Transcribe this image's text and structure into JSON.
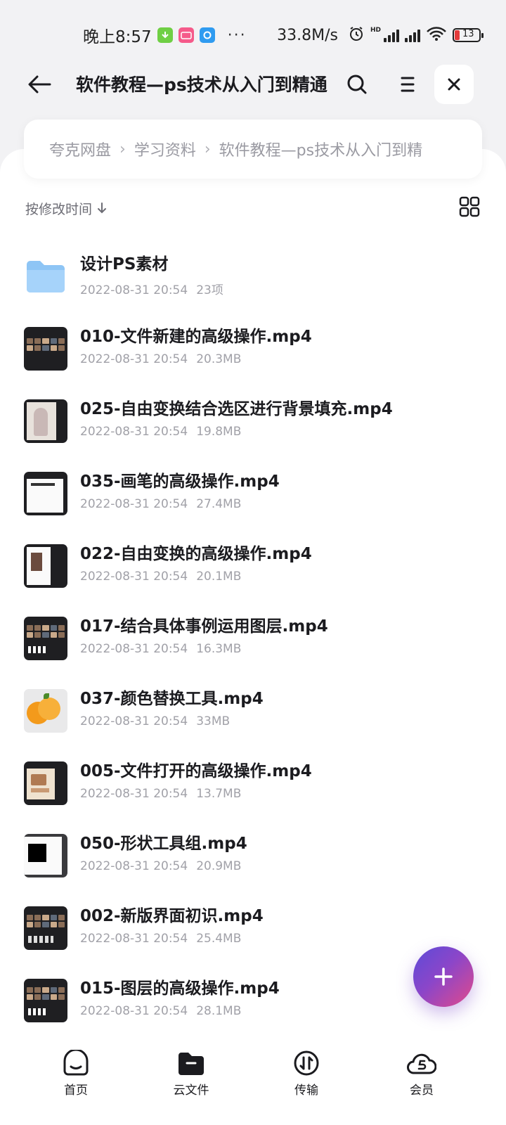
{
  "status_bar": {
    "time": "晚上8:57",
    "dots": "···",
    "net_speed": "33.8M/s",
    "hd_label": "HD",
    "battery": "13"
  },
  "header": {
    "title": "软件教程—ps技术从入门到精通"
  },
  "breadcrumb": [
    "夸克网盘",
    "学习资料",
    "软件教程—ps技术从入门到精"
  ],
  "sort": {
    "label": "按修改时间"
  },
  "files": [
    {
      "name": "设计PS素材",
      "date": "2022-08-31 20:54",
      "size": "23项",
      "icon": "folder-icon"
    },
    {
      "name": "010-文件新建的高级操作.mp4",
      "date": "2022-08-31 20:54",
      "size": "20.3MB",
      "icon": "video-thumbnail"
    },
    {
      "name": "025-自由变换结合选区进行背景填充.mp4",
      "date": "2022-08-31 20:54",
      "size": "19.8MB",
      "icon": "video-thumbnail"
    },
    {
      "name": "035-画笔的高级操作.mp4",
      "date": "2022-08-31 20:54",
      "size": "27.4MB",
      "icon": "video-thumbnail"
    },
    {
      "name": "022-自由变换的高级操作.mp4",
      "date": "2022-08-31 20:54",
      "size": "20.1MB",
      "icon": "video-thumbnail"
    },
    {
      "name": "017-结合具体事例运用图层.mp4",
      "date": "2022-08-31 20:54",
      "size": "16.3MB",
      "icon": "video-thumbnail"
    },
    {
      "name": "037-颜色替换工具.mp4",
      "date": "2022-08-31 20:54",
      "size": "33MB",
      "icon": "video-thumbnail"
    },
    {
      "name": "005-文件打开的高级操作.mp4",
      "date": "2022-08-31 20:54",
      "size": "13.7MB",
      "icon": "video-thumbnail"
    },
    {
      "name": "050-形状工具组.mp4",
      "date": "2022-08-31 20:54",
      "size": "20.9MB",
      "icon": "video-thumbnail"
    },
    {
      "name": "002-新版界面初识.mp4",
      "date": "2022-08-31 20:54",
      "size": "25.4MB",
      "icon": "video-thumbnail"
    },
    {
      "name": "015-图层的高级操作.mp4",
      "date": "2022-08-31 20:54",
      "size": "28.1MB",
      "icon": "video-thumbnail"
    }
  ],
  "nav": [
    {
      "label": "首页",
      "icon": "home-icon"
    },
    {
      "label": "云文件",
      "icon": "cloud-folder-icon"
    },
    {
      "label": "传输",
      "icon": "transfer-icon"
    },
    {
      "label": "会员",
      "icon": "member-icon"
    }
  ],
  "colors": {
    "background": "#f2f2f4",
    "text": "#1b1b1f",
    "meta_text": "#a1a1a8",
    "folder": "#8ec5f5",
    "fab_gradient_start": "#5c4bd8",
    "fab_gradient_end": "#e24a8a"
  }
}
